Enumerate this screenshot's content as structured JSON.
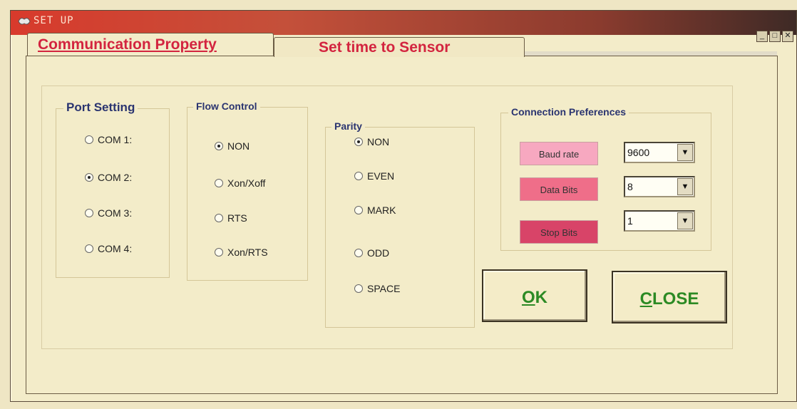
{
  "window": {
    "title": "SET UP"
  },
  "tabs": {
    "active": "Communication Property",
    "other": "Set time to Sensor"
  },
  "port_setting": {
    "label": "Port Setting",
    "options": [
      "COM 1:",
      "COM 2:",
      "COM 3:",
      "COM 4:"
    ],
    "selected": "COM 2:"
  },
  "flow_control": {
    "label": "Flow Control",
    "options": [
      "NON",
      "Xon/Xoff",
      "RTS",
      "Xon/RTS"
    ],
    "selected": "NON"
  },
  "parity": {
    "label": "Parity",
    "options": [
      "NON",
      "EVEN",
      "MARK",
      "ODD",
      "SPACE"
    ],
    "selected": "NON"
  },
  "connection_preferences": {
    "label": "Connection  Preferences",
    "baud_rate": {
      "label": "Baud rate",
      "value": "9600",
      "color": "#f7a8c0"
    },
    "data_bits": {
      "label": "Data Bits",
      "value": "8",
      "color": "#ef6e89"
    },
    "stop_bits": {
      "label": "Stop Bits",
      "value": "1",
      "color": "#d84468"
    }
  },
  "buttons": {
    "ok_prefix": "O",
    "ok_rest": "K",
    "close_prefix": "C",
    "close_rest": "LOSE"
  }
}
